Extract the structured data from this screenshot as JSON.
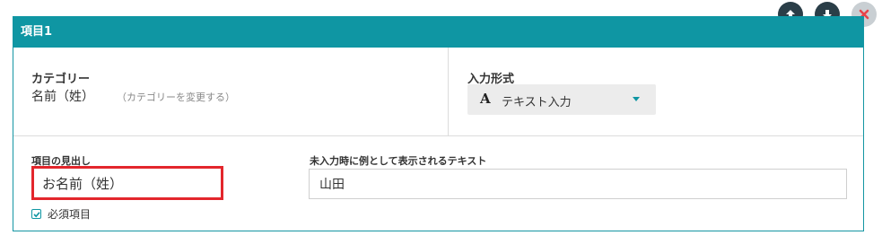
{
  "controls": {
    "move_up_icon": "arrow-up-icon",
    "move_down_icon": "arrow-down-icon",
    "delete_icon": "close-icon"
  },
  "panel": {
    "title": "項目1",
    "header_color": "#0f96a3"
  },
  "category": {
    "label": "カテゴリー",
    "value": "名前（姓）",
    "change_link": "（カテゴリーを変更する）"
  },
  "input_format": {
    "label": "入力形式",
    "icon_glyph": "A",
    "selected": "テキスト入力"
  },
  "item_heading": {
    "label": "項目の見出し",
    "value": "お名前（姓）",
    "highlight_color": "#e3262c"
  },
  "required": {
    "label": "必須項目",
    "checked": true
  },
  "placeholder_text": {
    "label": "未入力時に例として表示されるテキスト",
    "value": "山田"
  }
}
